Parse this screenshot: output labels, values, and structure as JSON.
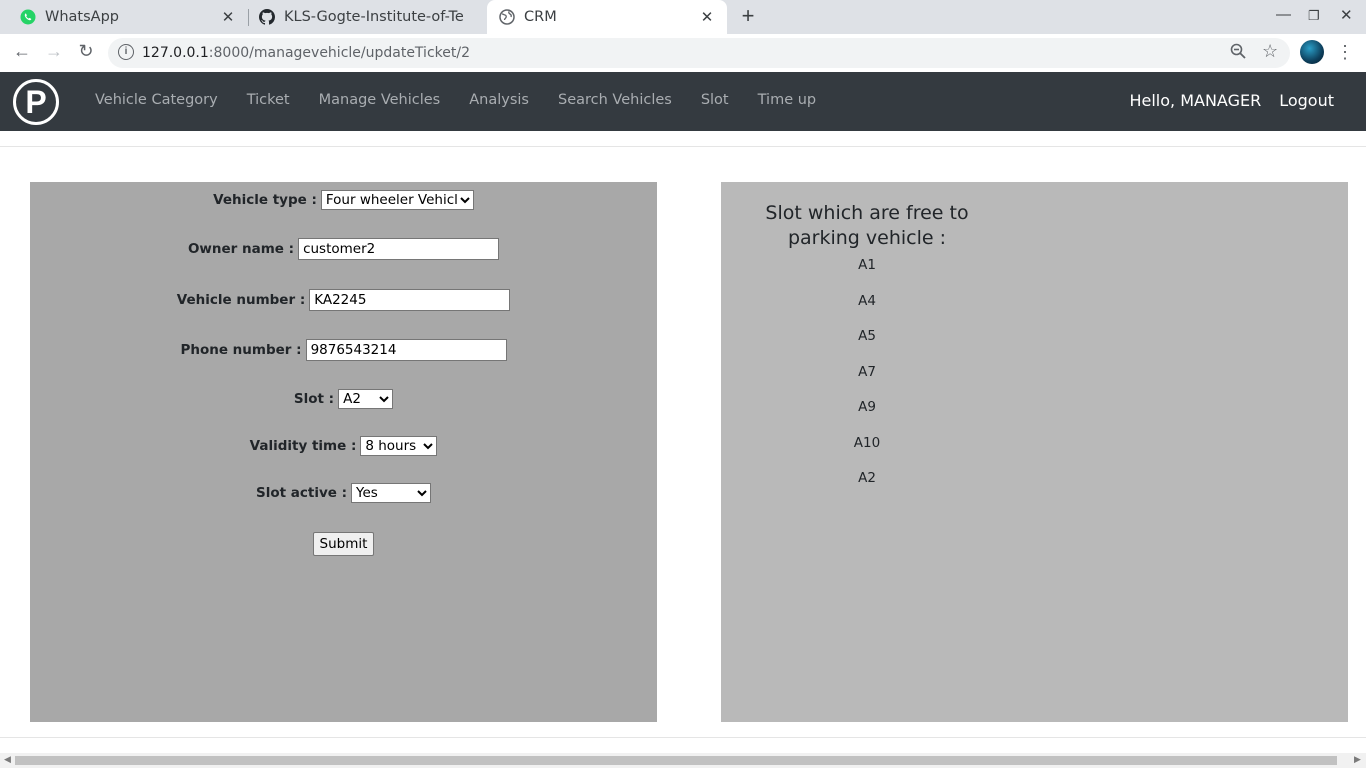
{
  "browser": {
    "tabs": [
      {
        "title": "WhatsApp",
        "icon": "whatsapp-icon"
      },
      {
        "title": "KLS-Gogte-Institute-of-Te",
        "icon": "github-icon"
      },
      {
        "title": "CRM",
        "icon": "globe-icon"
      }
    ],
    "url_host": "127.0.0.1",
    "url_path": ":8000/managevehicle/updateTicket/2"
  },
  "navbar": {
    "logo": "P",
    "links": [
      "Vehicle Category",
      "Ticket",
      "Manage Vehicles",
      "Analysis",
      "Search Vehicles",
      "Slot",
      "Time up"
    ],
    "greeting": "Hello, MANAGER",
    "logout": "Logout"
  },
  "form": {
    "vehicle_type_label": "Vehicle type :",
    "vehicle_type_value": "Four wheeler Vehicle",
    "owner_label": "Owner name :",
    "owner_value": "customer2",
    "vehicle_number_label": "Vehicle number :",
    "vehicle_number_value": "KA2245",
    "phone_label": "Phone number :",
    "phone_value": "9876543214",
    "slot_label": "Slot :",
    "slot_value": "A2",
    "validity_label": "Validity time :",
    "validity_value": "8 hours",
    "active_label": "Slot active :",
    "active_value": "Yes",
    "submit_label": "Submit"
  },
  "free_slots": {
    "heading": "Slot which are free to parking vehicle :",
    "slots": [
      "A1",
      "A4",
      "A5",
      "A7",
      "A9",
      "A10",
      "A2"
    ]
  },
  "colors": {
    "navbar_bg": "#343a40",
    "form_panel_bg": "#a8a8a8",
    "slot_panel_bg": "#b9b9b9"
  }
}
